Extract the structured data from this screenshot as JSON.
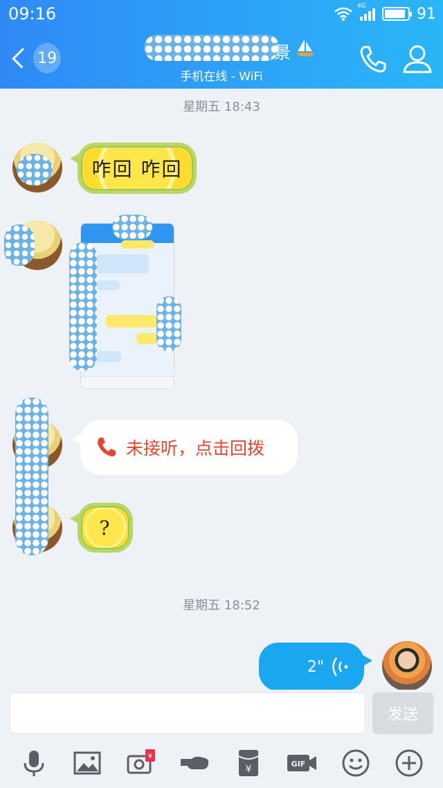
{
  "status_bar": {
    "time": "09:16",
    "network": "4G",
    "battery": "91",
    "battery_level": 0.91
  },
  "header": {
    "unread_count": "19",
    "title_suffix": "景",
    "subtitle": "手机在线 - WiFi"
  },
  "messages": {
    "timestamp_1": "星期五 18:43",
    "sticker_1_text": "咋回 咋回",
    "missed_call_text": "未接听，点击回拨",
    "sticker_2_text": "?",
    "timestamp_2": "星期五 18:52",
    "voice_duration": "2\""
  },
  "input": {
    "placeholder": "",
    "send_label": "发送"
  },
  "toolbar_icons": [
    "microphone-icon",
    "image-icon",
    "camera-redpacket-icon",
    "poke-icon",
    "redpacket-icon",
    "gif-icon",
    "emoji-icon",
    "plus-icon"
  ],
  "colors": {
    "header_start": "#2f8af6",
    "header_end": "#2ab6f7",
    "voice_bubble": "#1aa7ef",
    "missed_call": "#e8452f"
  }
}
